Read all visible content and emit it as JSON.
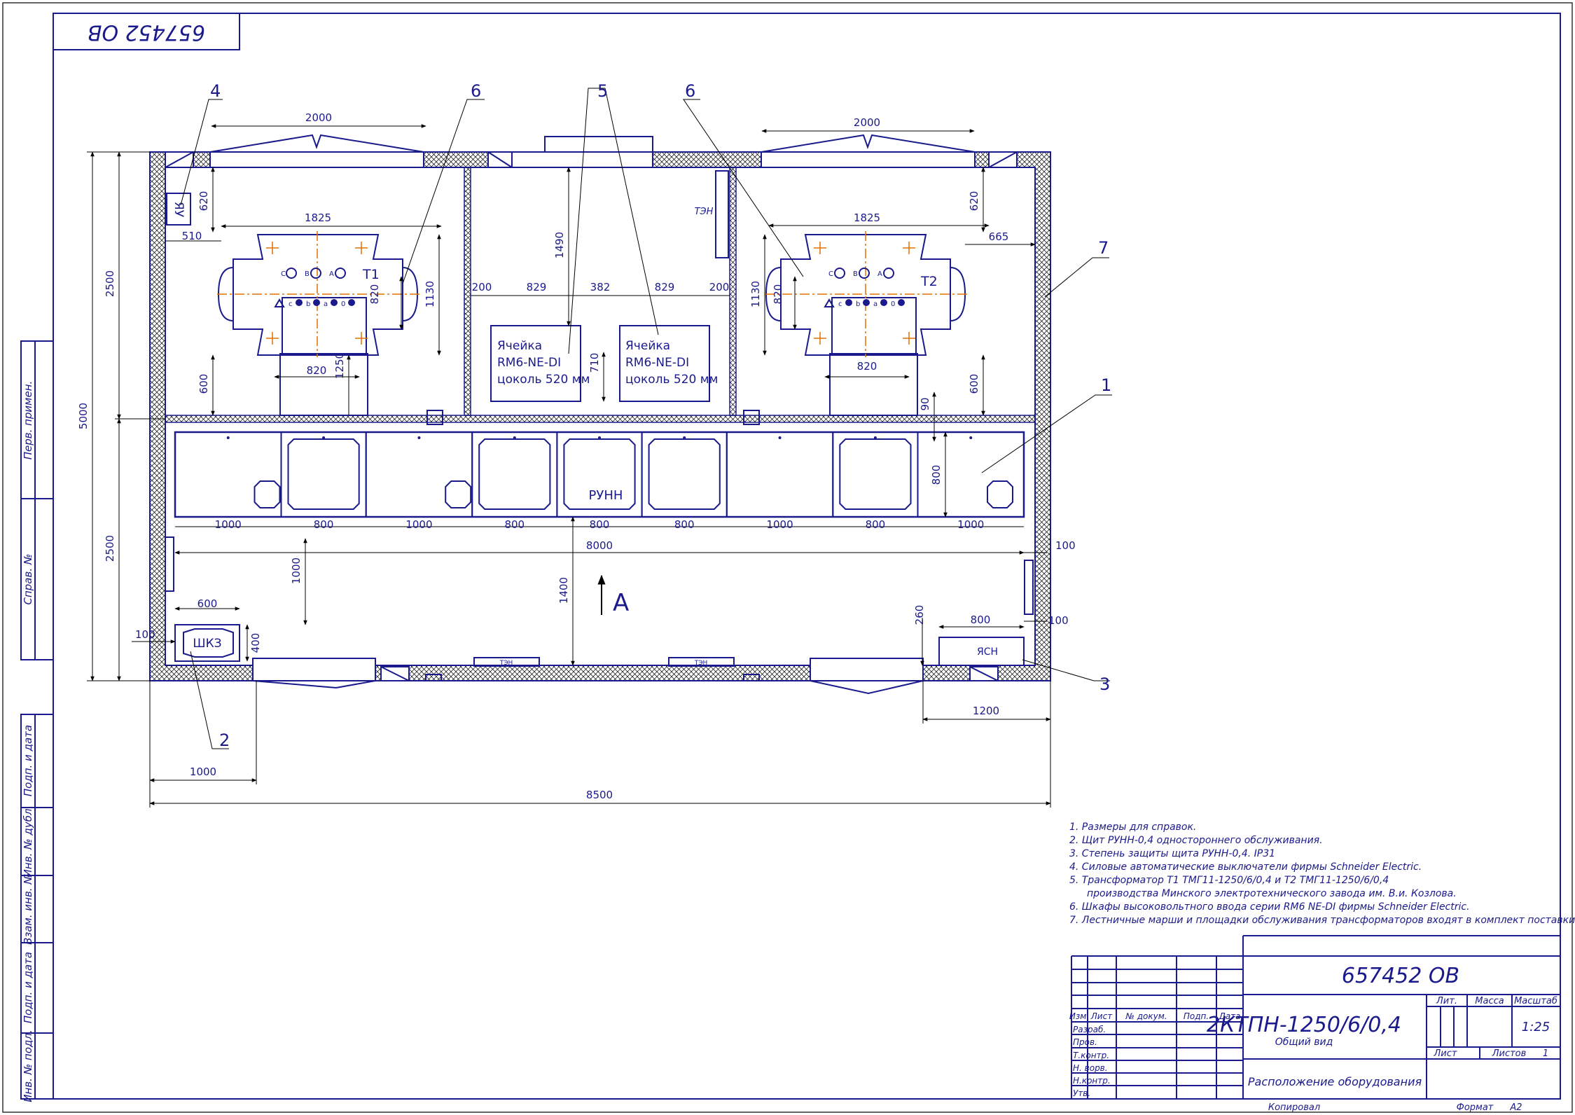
{
  "doc_code": "657452 ОВ",
  "doc_code_stamp": "657452 ОВ",
  "callouts": [
    "4",
    "6",
    "5",
    "6",
    "7",
    "1",
    "3",
    "2"
  ],
  "labels": {
    "t1": "Т1",
    "t2": "Т2",
    "yau": "ЯУ",
    "ten_upper": "ТЭН",
    "ten_lower_left": "ТЭН",
    "ten_lower_right": "ТЭН",
    "cell1_lines": [
      "Ячейка",
      "RM6-NE-DI",
      "цоколь 520 мм"
    ],
    "cell2_lines": [
      "Ячейка",
      "RM6-NE-DI",
      "цоколь 520 мм"
    ],
    "runn": "РУНН",
    "shkz": "ШКЗ",
    "yasn": "ЯСН",
    "view_a": "А",
    "phases_hv": [
      "C",
      "B",
      "A"
    ],
    "phases_lv": [
      "c",
      "b",
      "a",
      "0"
    ]
  },
  "dimensions": {
    "top_window_left": "2000",
    "top_window_right": "2000",
    "d620_left": "620",
    "d620_right": "620",
    "d1825_left": "1825",
    "d1825_right": "1825",
    "d510": "510",
    "d665": "665",
    "d1130_left": "1130",
    "d1130_right": "1130",
    "d820v_left": "820",
    "d820v_right": "820",
    "d820h_left": "820",
    "d820h_right": "820",
    "d1250": "1250",
    "d600_left": "600",
    "d600_right": "600",
    "d1490": "1490",
    "d200_left": "200",
    "d829_left": "829",
    "d382": "382",
    "d829_right": "829",
    "d200_right": "200",
    "d710": "710",
    "d90": "90",
    "d800_panel": "800",
    "panels": [
      "1000",
      "800",
      "1000",
      "800",
      "800",
      "800",
      "1000",
      "800",
      "1000"
    ],
    "d8000": "8000",
    "d100_top": "100",
    "d100_bottom": "100",
    "d1000_v": "1000",
    "d1400": "1400",
    "d600_shkz": "600",
    "d400": "400",
    "d100_left": "100",
    "d260": "260",
    "d800_yasn": "800",
    "d1200": "1200",
    "d1000_bottom": "1000",
    "d8500": "8500",
    "d5000": "5000",
    "d2500_top": "2500",
    "d2500_bottom": "2500"
  },
  "notes": [
    "1. Размеры для справок.",
    "2. Щит РУНН-0,4 одностороннего обслуживания.",
    "3. Степень защиты щита РУНН-0,4. IP31",
    "4. Силовые автоматические выключатели фирмы Schneider Electric.",
    "5. Трансформатор Т1 ТМГ11-1250/6/0,4 и Т2 ТМГ11-1250/6/0,4",
    "производства Минского электротехнического завода им. В.и. Козлова.",
    "6.  Шкафы высоковольтного ввода серии RM6 NE-DI фирмы Schneider Electric.",
    "7. Лестничные марши и площадки обслуживания трансформаторов входят в комплект поставки."
  ],
  "side_stamp": {
    "perv_primen": "Перв. примен.",
    "sprav": "Справ. №",
    "podp_data_1": "Подп. и дата",
    "inv_dubl": "Инв. № дубл.",
    "vzam_inv": "Взам. инв. №",
    "podp_data_2": "Подп. и дата",
    "inv_podl": "Инв. № подл."
  },
  "title_block": {
    "designation": "657452 ОВ",
    "product": "2КТПН-1250/6/0,4",
    "product_sub": "Общий вид",
    "sheet_title": "Расположение оборудования",
    "col_headers": [
      "Изм.",
      "Лист",
      "№ докум.",
      "Подп.",
      "Дата"
    ],
    "rows": [
      "Разраб.",
      "Пров.",
      "Т.контр.",
      "Н. ворв.",
      "Н.контр.",
      "Утв."
    ],
    "lit": "Лит.",
    "massa": "Масса",
    "masshtab": "Масштаб",
    "scale": "1:25",
    "list": "Лист",
    "listov": "Листов",
    "listov_val": "1",
    "kopiroval": "Копировал",
    "format": "Формат",
    "format_val": "А2"
  },
  "colors": {
    "line": "#1a1a8c",
    "dimension": "#000000",
    "axis": "#e07000",
    "hatch": "#000000",
    "paper": "#ffffff"
  }
}
